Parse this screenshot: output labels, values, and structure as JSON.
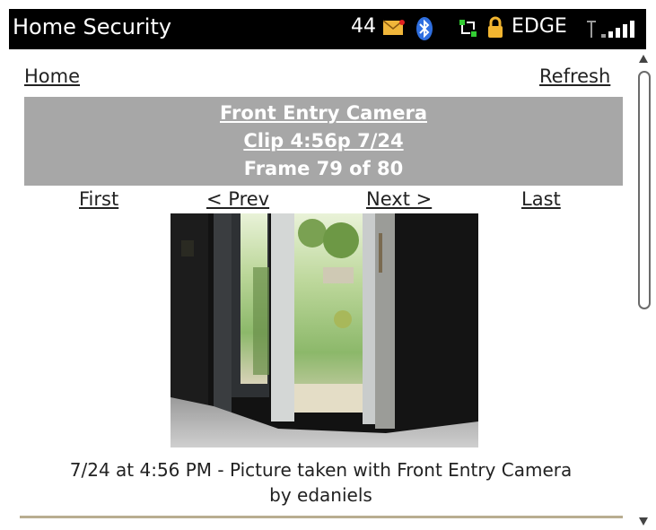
{
  "status_bar": {
    "app_title": "Home Security",
    "count": "44",
    "network_type": "EDGE",
    "icons": [
      "mail-notification-icon",
      "bluetooth-icon",
      "network-activity-icon",
      "lock-icon",
      "signal-strength-icon"
    ]
  },
  "nav": {
    "home_label": "Home",
    "refresh_label": "Refresh"
  },
  "header": {
    "camera_name": "Front Entry Camera",
    "clip": "Clip 4:56p 7/24",
    "frame": "Frame 79 of 80"
  },
  "pager": {
    "first": "First",
    "prev": "< Prev",
    "next": "Next >",
    "last": "Last"
  },
  "caption": {
    "line1": "7/24 at 4:56 PM - Picture taken with Front Entry Camera",
    "line2": "by edaniels"
  },
  "colors": {
    "status_bar_bg": "#000000",
    "header_bg": "#a7a7a7",
    "link": "#222222",
    "separator": "#b9ad90"
  }
}
